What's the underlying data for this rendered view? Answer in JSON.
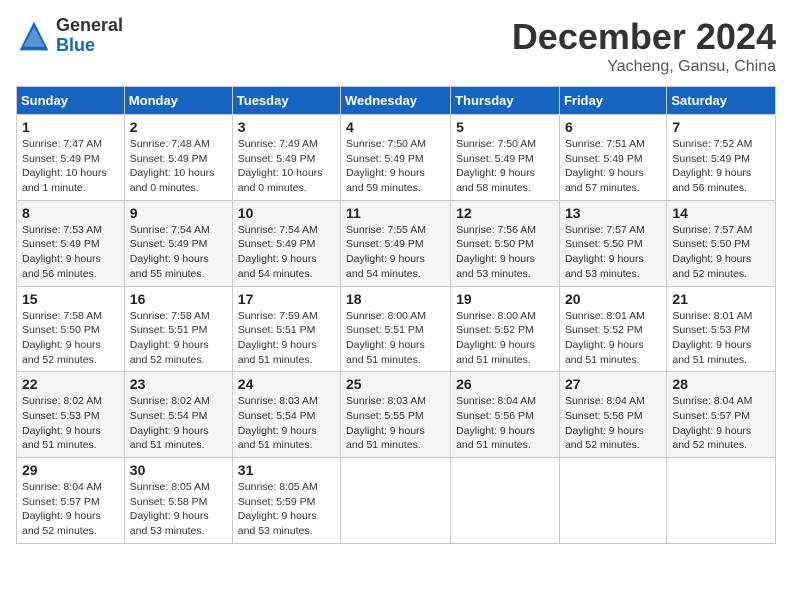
{
  "header": {
    "logo_general": "General",
    "logo_blue": "Blue",
    "month_title": "December 2024",
    "location": "Yacheng, Gansu, China"
  },
  "weekdays": [
    "Sunday",
    "Monday",
    "Tuesday",
    "Wednesday",
    "Thursday",
    "Friday",
    "Saturday"
  ],
  "weeks": [
    [
      {
        "day": "1",
        "sunrise": "Sunrise: 7:47 AM",
        "sunset": "Sunset: 5:49 PM",
        "daylight": "Daylight: 10 hours and 1 minute."
      },
      {
        "day": "2",
        "sunrise": "Sunrise: 7:48 AM",
        "sunset": "Sunset: 5:49 PM",
        "daylight": "Daylight: 10 hours and 0 minutes."
      },
      {
        "day": "3",
        "sunrise": "Sunrise: 7:49 AM",
        "sunset": "Sunset: 5:49 PM",
        "daylight": "Daylight: 10 hours and 0 minutes."
      },
      {
        "day": "4",
        "sunrise": "Sunrise: 7:50 AM",
        "sunset": "Sunset: 5:49 PM",
        "daylight": "Daylight: 9 hours and 59 minutes."
      },
      {
        "day": "5",
        "sunrise": "Sunrise: 7:50 AM",
        "sunset": "Sunset: 5:49 PM",
        "daylight": "Daylight: 9 hours and 58 minutes."
      },
      {
        "day": "6",
        "sunrise": "Sunrise: 7:51 AM",
        "sunset": "Sunset: 5:49 PM",
        "daylight": "Daylight: 9 hours and 57 minutes."
      },
      {
        "day": "7",
        "sunrise": "Sunrise: 7:52 AM",
        "sunset": "Sunset: 5:49 PM",
        "daylight": "Daylight: 9 hours and 56 minutes."
      }
    ],
    [
      {
        "day": "8",
        "sunrise": "Sunrise: 7:53 AM",
        "sunset": "Sunset: 5:49 PM",
        "daylight": "Daylight: 9 hours and 56 minutes."
      },
      {
        "day": "9",
        "sunrise": "Sunrise: 7:54 AM",
        "sunset": "Sunset: 5:49 PM",
        "daylight": "Daylight: 9 hours and 55 minutes."
      },
      {
        "day": "10",
        "sunrise": "Sunrise: 7:54 AM",
        "sunset": "Sunset: 5:49 PM",
        "daylight": "Daylight: 9 hours and 54 minutes."
      },
      {
        "day": "11",
        "sunrise": "Sunrise: 7:55 AM",
        "sunset": "Sunset: 5:49 PM",
        "daylight": "Daylight: 9 hours and 54 minutes."
      },
      {
        "day": "12",
        "sunrise": "Sunrise: 7:56 AM",
        "sunset": "Sunset: 5:50 PM",
        "daylight": "Daylight: 9 hours and 53 minutes."
      },
      {
        "day": "13",
        "sunrise": "Sunrise: 7:57 AM",
        "sunset": "Sunset: 5:50 PM",
        "daylight": "Daylight: 9 hours and 53 minutes."
      },
      {
        "day": "14",
        "sunrise": "Sunrise: 7:57 AM",
        "sunset": "Sunset: 5:50 PM",
        "daylight": "Daylight: 9 hours and 52 minutes."
      }
    ],
    [
      {
        "day": "15",
        "sunrise": "Sunrise: 7:58 AM",
        "sunset": "Sunset: 5:50 PM",
        "daylight": "Daylight: 9 hours and 52 minutes."
      },
      {
        "day": "16",
        "sunrise": "Sunrise: 7:58 AM",
        "sunset": "Sunset: 5:51 PM",
        "daylight": "Daylight: 9 hours and 52 minutes."
      },
      {
        "day": "17",
        "sunrise": "Sunrise: 7:59 AM",
        "sunset": "Sunset: 5:51 PM",
        "daylight": "Daylight: 9 hours and 51 minutes."
      },
      {
        "day": "18",
        "sunrise": "Sunrise: 8:00 AM",
        "sunset": "Sunset: 5:51 PM",
        "daylight": "Daylight: 9 hours and 51 minutes."
      },
      {
        "day": "19",
        "sunrise": "Sunrise: 8:00 AM",
        "sunset": "Sunset: 5:52 PM",
        "daylight": "Daylight: 9 hours and 51 minutes."
      },
      {
        "day": "20",
        "sunrise": "Sunrise: 8:01 AM",
        "sunset": "Sunset: 5:52 PM",
        "daylight": "Daylight: 9 hours and 51 minutes."
      },
      {
        "day": "21",
        "sunrise": "Sunrise: 8:01 AM",
        "sunset": "Sunset: 5:53 PM",
        "daylight": "Daylight: 9 hours and 51 minutes."
      }
    ],
    [
      {
        "day": "22",
        "sunrise": "Sunrise: 8:02 AM",
        "sunset": "Sunset: 5:53 PM",
        "daylight": "Daylight: 9 hours and 51 minutes."
      },
      {
        "day": "23",
        "sunrise": "Sunrise: 8:02 AM",
        "sunset": "Sunset: 5:54 PM",
        "daylight": "Daylight: 9 hours and 51 minutes."
      },
      {
        "day": "24",
        "sunrise": "Sunrise: 8:03 AM",
        "sunset": "Sunset: 5:54 PM",
        "daylight": "Daylight: 9 hours and 51 minutes."
      },
      {
        "day": "25",
        "sunrise": "Sunrise: 8:03 AM",
        "sunset": "Sunset: 5:55 PM",
        "daylight": "Daylight: 9 hours and 51 minutes."
      },
      {
        "day": "26",
        "sunrise": "Sunrise: 8:04 AM",
        "sunset": "Sunset: 5:56 PM",
        "daylight": "Daylight: 9 hours and 51 minutes."
      },
      {
        "day": "27",
        "sunrise": "Sunrise: 8:04 AM",
        "sunset": "Sunset: 5:56 PM",
        "daylight": "Daylight: 9 hours and 52 minutes."
      },
      {
        "day": "28",
        "sunrise": "Sunrise: 8:04 AM",
        "sunset": "Sunset: 5:57 PM",
        "daylight": "Daylight: 9 hours and 52 minutes."
      }
    ],
    [
      {
        "day": "29",
        "sunrise": "Sunrise: 8:04 AM",
        "sunset": "Sunset: 5:57 PM",
        "daylight": "Daylight: 9 hours and 52 minutes."
      },
      {
        "day": "30",
        "sunrise": "Sunrise: 8:05 AM",
        "sunset": "Sunset: 5:58 PM",
        "daylight": "Daylight: 9 hours and 53 minutes."
      },
      {
        "day": "31",
        "sunrise": "Sunrise: 8:05 AM",
        "sunset": "Sunset: 5:59 PM",
        "daylight": "Daylight: 9 hours and 53 minutes."
      },
      null,
      null,
      null,
      null
    ]
  ]
}
